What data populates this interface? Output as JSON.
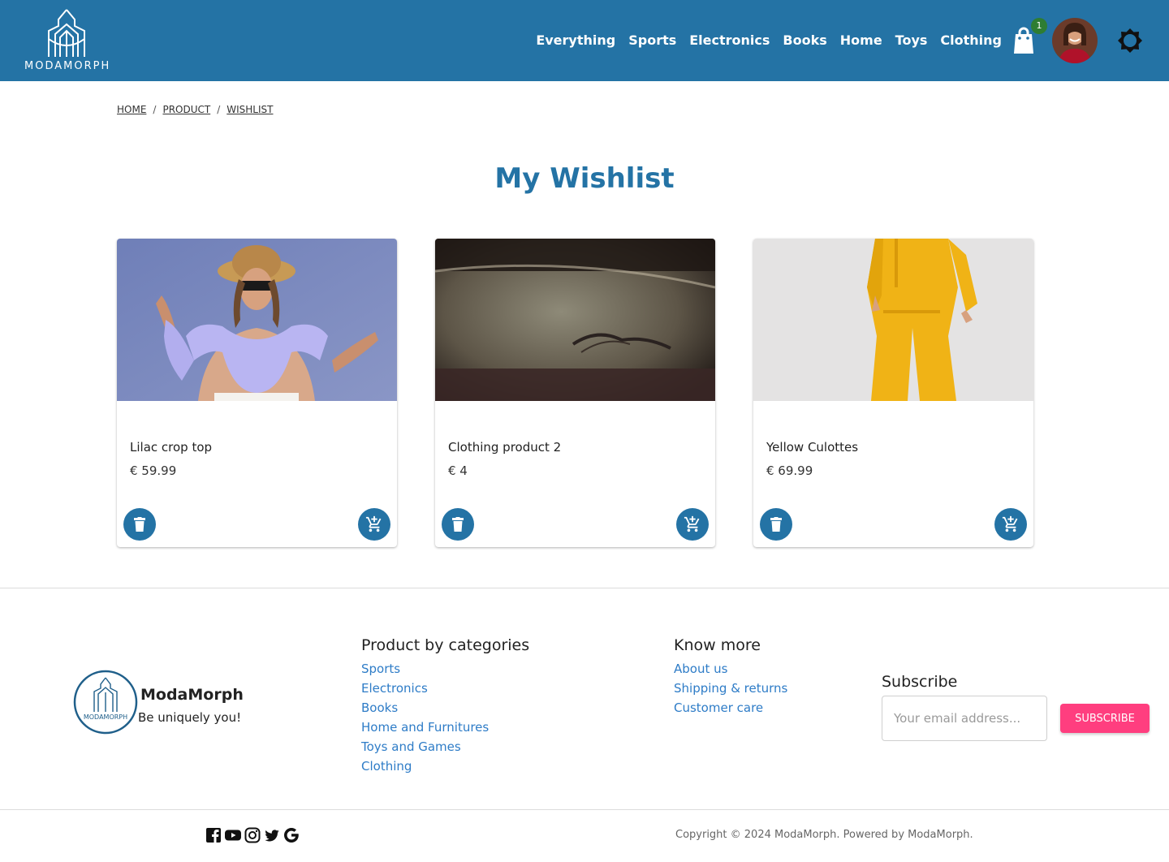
{
  "header": {
    "logo_text": "MODAMORPH",
    "nav": [
      "Everything",
      "Sports",
      "Electronics",
      "Books",
      "Home",
      "Toys",
      "Clothing"
    ],
    "cart_count": "1",
    "accent": "#2473a5"
  },
  "breadcrumb": [
    "HOME",
    "PRODUCT",
    "WISHLIST"
  ],
  "page_title": "My Wishlist",
  "products": [
    {
      "name": "Lilac crop top",
      "price": "€ 59.99"
    },
    {
      "name": "Clothing product 2",
      "price": "€ 4"
    },
    {
      "name": "Yellow Culottes",
      "price": "€ 69.99"
    }
  ],
  "footer": {
    "brand": "ModaMorph",
    "slogan": "Be uniquely you!",
    "categories_title": "Product by categories",
    "categories": [
      "Sports",
      "Electronics",
      "Books",
      "Home and Furnitures",
      "Toys and Games",
      "Clothing"
    ],
    "know_title": "Know more",
    "know_links": [
      "About us",
      "Shipping & returns",
      "Customer care"
    ],
    "subscribe_title": "Subscribe",
    "email_placeholder": "Your email address...",
    "subscribe_button": "SUBSCRIBE",
    "socials": [
      "facebook-icon",
      "youtube-icon",
      "instagram-icon",
      "twitter-icon",
      "google-icon"
    ],
    "copyright": "Copyright © 2024 ModaMorph. Powered by ModaMorph."
  }
}
